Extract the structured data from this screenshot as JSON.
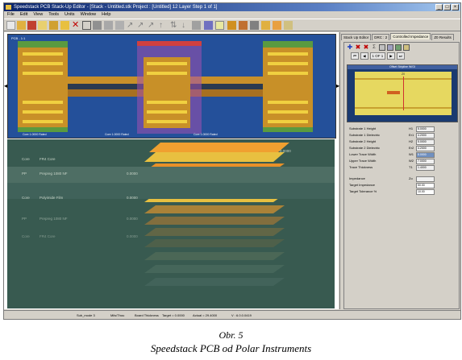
{
  "window": {
    "title": "Speedstack PCB Stack-Up Editor - [Stack - Untitled.stk   Project : [Untitled]   12 Layer   Step 1 of 1]",
    "controls": [
      "_",
      "□",
      "×"
    ]
  },
  "menu": [
    "File",
    "Edit",
    "View",
    "Tools",
    "Units",
    "Window",
    "Help"
  ],
  "view3d": {
    "corner_label": "PCB - 1:1",
    "bottom_labels": [
      "Core 1.0000 Rated",
      "Core 1.0000 Rated",
      "Core 1.0000 Rated"
    ]
  },
  "stack_rows": [
    {
      "name": "Core",
      "material": "FR4 Core",
      "thickness": "0.0000"
    },
    {
      "name": "PP",
      "material": "Prepreg 1080 NF",
      "thickness": "0.0000"
    },
    {
      "name": "Core",
      "material": "Polyimide Film",
      "thickness": "0.0000"
    },
    {
      "name": "PP",
      "material": "Prepreg 1080 NF",
      "thickness": "0.0000"
    },
    {
      "name": "Core",
      "material": "FR4 Core",
      "thickness": "0.0000"
    }
  ],
  "right_panel": {
    "tabs": [
      "Stack Up Editor",
      "DRC : 2",
      "Controlled Impedance",
      "Z0 Results"
    ],
    "active_tab": 2,
    "page": "1 OF 1",
    "graph_title": "Offset Stripline W/GI",
    "graph_subtitle": "Z0",
    "fields": [
      {
        "label": "Substrate 1 Height",
        "symbol": "H1",
        "value": "5.0000"
      },
      {
        "label": "Substrate 1 Dielectric",
        "symbol": "Er1",
        "value": "4.2000"
      },
      {
        "label": "Substrate 2 Height",
        "symbol": "H2",
        "value": "5.0000"
      },
      {
        "label": "Substrate 2 Dielectric",
        "symbol": "Er2",
        "value": "4.2000"
      },
      {
        "label": "Lower Trace Width",
        "symbol": "W1",
        "value": "8.0000"
      },
      {
        "label": "Upper Trace Width",
        "symbol": "W2",
        "value": "7.0000"
      },
      {
        "label": "Trace Thickness",
        "symbol": "T1",
        "value": "1.4000"
      }
    ],
    "impedance": {
      "label": "Impedance",
      "symbol": "Zo",
      "value": ""
    },
    "target_impedance": {
      "label": "Target Impedance",
      "value": "50.00"
    },
    "target_tolerance": {
      "label": "Target Tolerance %",
      "value": "10.00"
    }
  },
  "status": {
    "sub_mode": "Sub_mode 3",
    "units": "Mils/Thou",
    "board_thickness_label": "Board Thickness",
    "target": "Target = 0.0000",
    "actual": "Actual = 29.4000",
    "version": "V : 6.0.0.0419"
  },
  "caption": {
    "line1": "Obr. 5",
    "line2": "Speedstack PCB od Polar Instruments"
  },
  "colors": {
    "board": "#e8c040",
    "core_bg": "#2a55a0",
    "stack_bg": "#385a50",
    "accent": "#c04040"
  }
}
